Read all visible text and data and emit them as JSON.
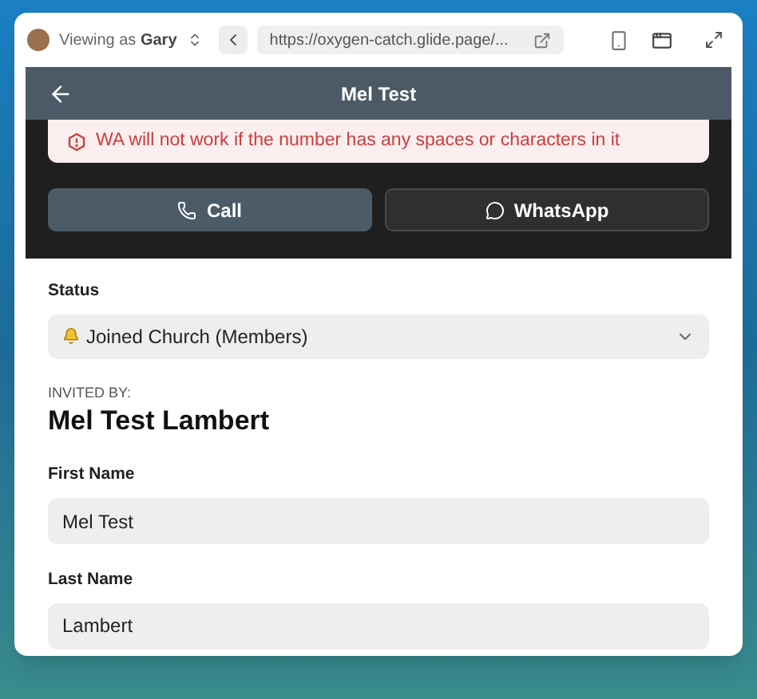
{
  "browser": {
    "viewer_prefix": "Viewing as",
    "viewer_name": "Gary",
    "url": "https://oxygen-catch.glide.page/..."
  },
  "header": {
    "title": "Mel Test"
  },
  "alert": {
    "text": "WA will not work if the number has any spaces or characters in it"
  },
  "actions": [
    {
      "label": "Call",
      "kind": "call"
    },
    {
      "label": "WhatsApp",
      "kind": "whatsapp"
    }
  ],
  "status": {
    "label": "Status",
    "value": "Joined Church (Members)"
  },
  "invited_by": {
    "label": "INVITED BY:",
    "value": "Mel Test Lambert"
  },
  "fields": [
    {
      "label": "First Name",
      "value": "Mel Test"
    },
    {
      "label": "Last Name",
      "value": "Lambert"
    }
  ]
}
